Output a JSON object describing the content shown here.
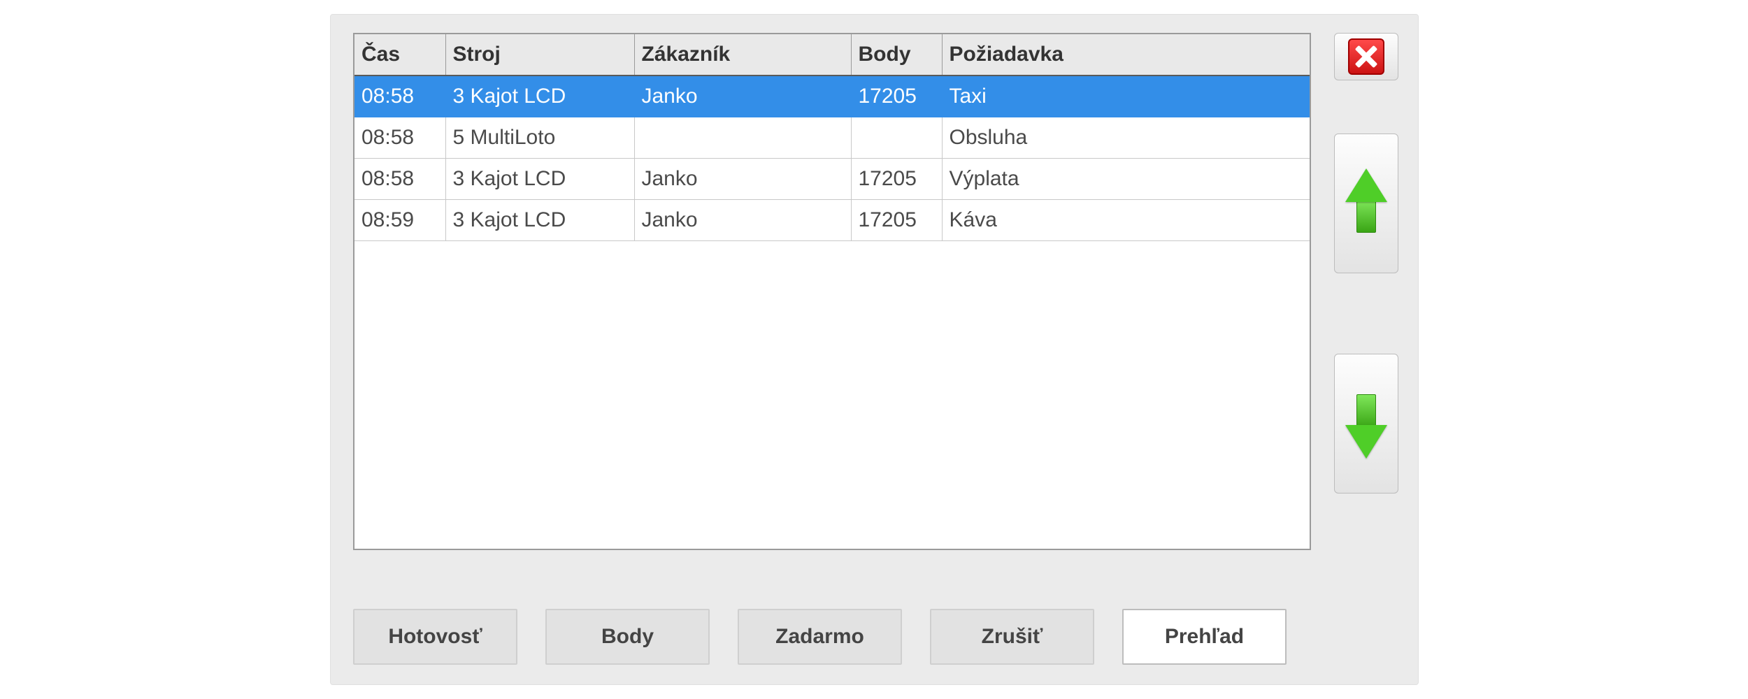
{
  "table": {
    "headers": {
      "time": "Čas",
      "machine": "Stroj",
      "customer": "Zákazník",
      "points": "Body",
      "request": "Požiadavka"
    },
    "rows": [
      {
        "time": "08:58",
        "machine": "3 Kajot LCD",
        "customer": "Janko",
        "points": "17205",
        "request": "Taxi",
        "selected": true
      },
      {
        "time": "08:58",
        "machine": "5 MultiLoto",
        "customer": "",
        "points": "",
        "request": "Obsluha",
        "selected": false
      },
      {
        "time": "08:58",
        "machine": "3 Kajot LCD",
        "customer": "Janko",
        "points": "17205",
        "request": "Výplata",
        "selected": false
      },
      {
        "time": "08:59",
        "machine": "3 Kajot LCD",
        "customer": "Janko",
        "points": "17205",
        "request": "Káva",
        "selected": false
      }
    ]
  },
  "buttons": {
    "cash": "Hotovosť",
    "points": "Body",
    "free": "Zadarmo",
    "cancel": "Zrušiť",
    "overview": "Prehľad"
  }
}
